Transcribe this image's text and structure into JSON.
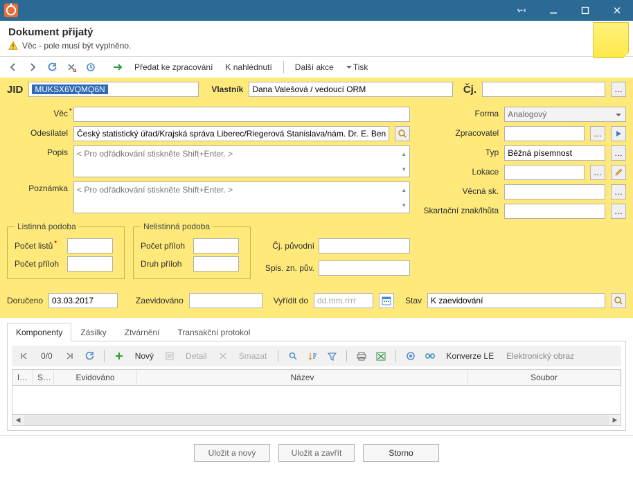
{
  "window": {
    "title": "Dokument přijatý",
    "warning_text": "Věc - pole musí být vyplněno."
  },
  "toolbar": {
    "action_forward": "Předat ke zpracování",
    "action_view": "K nahlédnutí",
    "more_actions": "Další akce",
    "print": "Tisk"
  },
  "jid_bar": {
    "jid_label": "JID",
    "jid_value": "MUKSX6VQMQ6N",
    "owner_label": "Vlastník",
    "owner_value": "Dana Valešová / vedoucí ORM",
    "cj_label": "Čj.",
    "cj_value": ""
  },
  "form": {
    "subject_label": "Věc",
    "subject_value": "",
    "sender_label": "Odesílatel",
    "sender_value": "Český statistický úřad/Krajská správa Liberec/Riegerová Stanislava/nám. Dr. E. Ben",
    "desc_label": "Popis",
    "desc_placeholder": "< Pro odřádkování stiskněte Shift+Enter. >",
    "note_label": "Poznámka",
    "note_placeholder": "< Pro odřádkování stiskněte Shift+Enter. >",
    "form_label": "Forma",
    "form_value": "Analogový",
    "processor_label": "Zpracovatel",
    "processor_value": "",
    "type_label": "Typ",
    "type_value": "Běžná písemnost",
    "location_label": "Lokace",
    "location_value": "",
    "subject_group_label": "Věcná sk.",
    "subject_group_value": "",
    "shred_label": "Skartační znak/lhůta",
    "shred_value": "",
    "fs_paper_legend": "Listinná podoba",
    "sheet_count_label": "Počet listů",
    "sheet_count_value": "",
    "att_count1_label": "Počet příloh",
    "att_count1_value": "",
    "fs_nonpaper_legend": "Nelistinná podoba",
    "att_count2_label": "Počet příloh",
    "att_count2_value": "",
    "att_kind_label": "Druh příloh",
    "att_kind_value": "",
    "orig_cj_label": "Čj. původní",
    "orig_cj_value": "",
    "orig_sp_label": "Spis. zn. pův.",
    "orig_sp_value": ""
  },
  "meta": {
    "delivered_label": "Doručeno",
    "delivered_value": "03.03.2017",
    "registered_label": "Zaevidováno",
    "registered_value": "",
    "due_label": "Vyřídit do",
    "due_placeholder": "dd.mm.rrrr",
    "status_label": "Stav",
    "status_value": "K zaevidování"
  },
  "tabs": {
    "t0": "Komponenty",
    "t1": "Zásilky",
    "t2": "Ztvárnění",
    "t3": "Transakční protokol"
  },
  "tab_tb": {
    "counter": "0/0",
    "new": "Nový",
    "detail": "Detail",
    "delete": "Smazat",
    "konverze": "Konverze LE",
    "eobraz": "Elektronický obraz"
  },
  "grid_cols": {
    "c0": "I…",
    "c1": "S…",
    "c2": "Evidováno",
    "c3": "Název",
    "c4": "Soubor"
  },
  "footer": {
    "save_new": "Uložit a nový",
    "save_close": "Uložit a zavřít",
    "cancel": "Storno"
  }
}
